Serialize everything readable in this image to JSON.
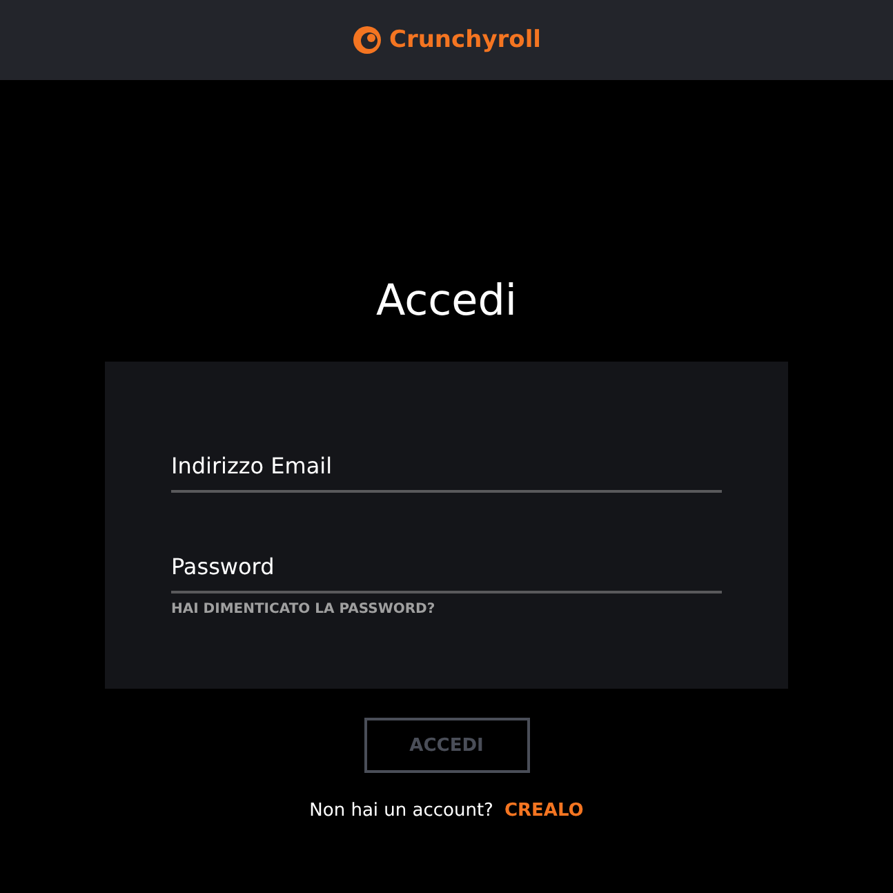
{
  "header": {
    "logo_text": "Crunchyroll"
  },
  "title": "Accedi",
  "form": {
    "fields": [
      {
        "placeholder": "Indirizzo Email",
        "kind": "email"
      },
      {
        "placeholder": "Password",
        "kind": "password"
      }
    ],
    "forgot_link": "HAI DIMENTICATO LA PASSWORD?"
  },
  "submit": {
    "label": "ACCEDI",
    "disabled": true
  },
  "signup": {
    "prompt": "Non hai un account?",
    "link": "CREALO"
  }
}
